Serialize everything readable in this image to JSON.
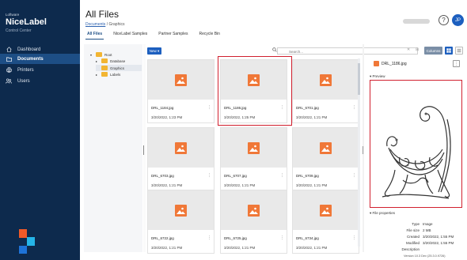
{
  "sidebar": {
    "brand_small": "Loftware",
    "brand": "NiceLabel",
    "subtitle": "Control Center",
    "items": [
      {
        "label": "Dashboard",
        "icon": "home-icon"
      },
      {
        "label": "Documents",
        "icon": "folder-icon",
        "active": true
      },
      {
        "label": "Printers",
        "icon": "printer-icon"
      },
      {
        "label": "Users",
        "icon": "users-icon"
      }
    ]
  },
  "header": {
    "title": "All Files",
    "breadcrumb_link": "Documents",
    "breadcrumb_sep": "/",
    "breadcrumb_current": "Graphics",
    "tabs": [
      "All Files",
      "NiceLabel Samples",
      "Partner Samples",
      "Recycle Bin"
    ],
    "help_icon": "?",
    "avatar_initials": "JP"
  },
  "tree": {
    "root": "Root",
    "children": [
      "Database",
      "Graphics",
      "Labels"
    ]
  },
  "toolbar": {
    "new_label": "New ▾",
    "search_placeholder": "Search...",
    "columns_label": "Columns"
  },
  "files": [
    {
      "name": "DRL_1184.jpg",
      "date": "3/20/2022, 1:23 PM"
    },
    {
      "name": "DRL_1186.jpg",
      "date": "3/20/2022, 1:25 PM",
      "selected": true
    },
    {
      "name": "DRL_6701.jpg",
      "date": "3/20/2022, 1:21 PM"
    },
    {
      "name": "DRL_6703.jpg",
      "date": "3/20/2022, 1:21 PM"
    },
    {
      "name": "DRL_6707.jpg",
      "date": "3/20/2022, 1:21 PM"
    },
    {
      "name": "DRL_6709.jpg",
      "date": "3/20/2022, 1:21 PM"
    },
    {
      "name": "DRL_6722.jpg",
      "date": "3/20/2022, 1:21 PM"
    },
    {
      "name": "DRL_6725.jpg",
      "date": "3/20/2022, 1:21 PM"
    },
    {
      "name": "DRL_6734.jpg",
      "date": "3/20/2022, 1:21 PM"
    }
  ],
  "details": {
    "file_name": "DRL_1186.jpg",
    "preview_label": "Preview",
    "properties_label": "File properties",
    "properties": [
      {
        "key": "Type",
        "value": "Image"
      },
      {
        "key": "File size",
        "value": "2 MB"
      },
      {
        "key": "Created",
        "value": "3/20/2022, 1:55 PM"
      },
      {
        "key": "Modified",
        "value": "3/20/2022, 1:55 PM"
      },
      {
        "key": "Description",
        "value": ""
      }
    ]
  },
  "version": "Version 10.3 Dev (25.3.0.9726)",
  "colors": {
    "sidebar": "#0d2a4d",
    "accent": "#1d5fbf",
    "highlight": "#d1202f",
    "image_icon": "#f07838"
  }
}
